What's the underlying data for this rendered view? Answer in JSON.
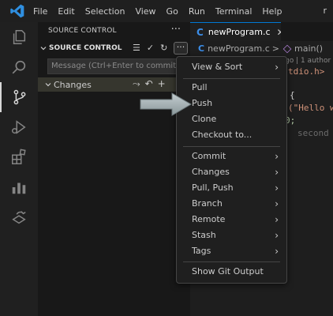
{
  "menu_bar": {
    "items": [
      "File",
      "Edit",
      "Selection",
      "View",
      "Go",
      "Run",
      "Terminal",
      "Help"
    ],
    "right_text": "r"
  },
  "activity_bar": {
    "icons": [
      "explorer-icon",
      "search-icon",
      "source-control-icon",
      "run-debug-icon",
      "extensions-icon",
      "chart-icon",
      "remote-icon"
    ],
    "active": "source-control-icon"
  },
  "sidebar": {
    "header": "SOURCE CONTROL",
    "more": "···",
    "section_title": "SOURCE CONTROL",
    "section_icons": [
      "☰",
      "✓",
      "↻"
    ],
    "section_more": "···",
    "message_placeholder": "Message (Ctrl+Enter to commit on",
    "changes_label": "Changes",
    "changes_icons": [
      "⤳",
      "↶",
      "+"
    ]
  },
  "editor": {
    "tab": {
      "badge": "C",
      "label": "newProgram.c",
      "close": "✕"
    },
    "breadcrumb": {
      "badge": "C",
      "file": "newProgram.c",
      "sep": ">",
      "symbol": "main()"
    },
    "codelens": "go | 1 author",
    "code": [
      {
        "text": "tdio.h>",
        "color": "#ce9178"
      },
      {
        "text": "{",
        "color": "#d4d4d4"
      },
      {
        "text": "(\"Hello w",
        "color": "#ce9178"
      },
      {
        "text": " 0;",
        "color": "#b5cea8"
      },
      {
        "text": "second",
        "color": "#6a6a6a"
      }
    ]
  },
  "context_menu": {
    "groups": [
      [
        {
          "label": "View & Sort",
          "submenu": true
        }
      ],
      [
        {
          "label": "Pull",
          "submenu": false
        },
        {
          "label": "Push",
          "submenu": false
        },
        {
          "label": "Clone",
          "submenu": false
        },
        {
          "label": "Checkout to...",
          "submenu": false
        }
      ],
      [
        {
          "label": "Commit",
          "submenu": true
        },
        {
          "label": "Changes",
          "submenu": true
        },
        {
          "label": "Pull, Push",
          "submenu": true
        },
        {
          "label": "Branch",
          "submenu": true
        },
        {
          "label": "Remote",
          "submenu": true
        },
        {
          "label": "Stash",
          "submenu": true
        },
        {
          "label": "Tags",
          "submenu": true
        }
      ],
      [
        {
          "label": "Show Git Output",
          "submenu": false
        }
      ]
    ],
    "submenu_glyph": "›"
  },
  "colors": {
    "accent": "#0078d4",
    "c_badge": "#3b8eea",
    "annotation_arrow": "#9aa6a8"
  }
}
